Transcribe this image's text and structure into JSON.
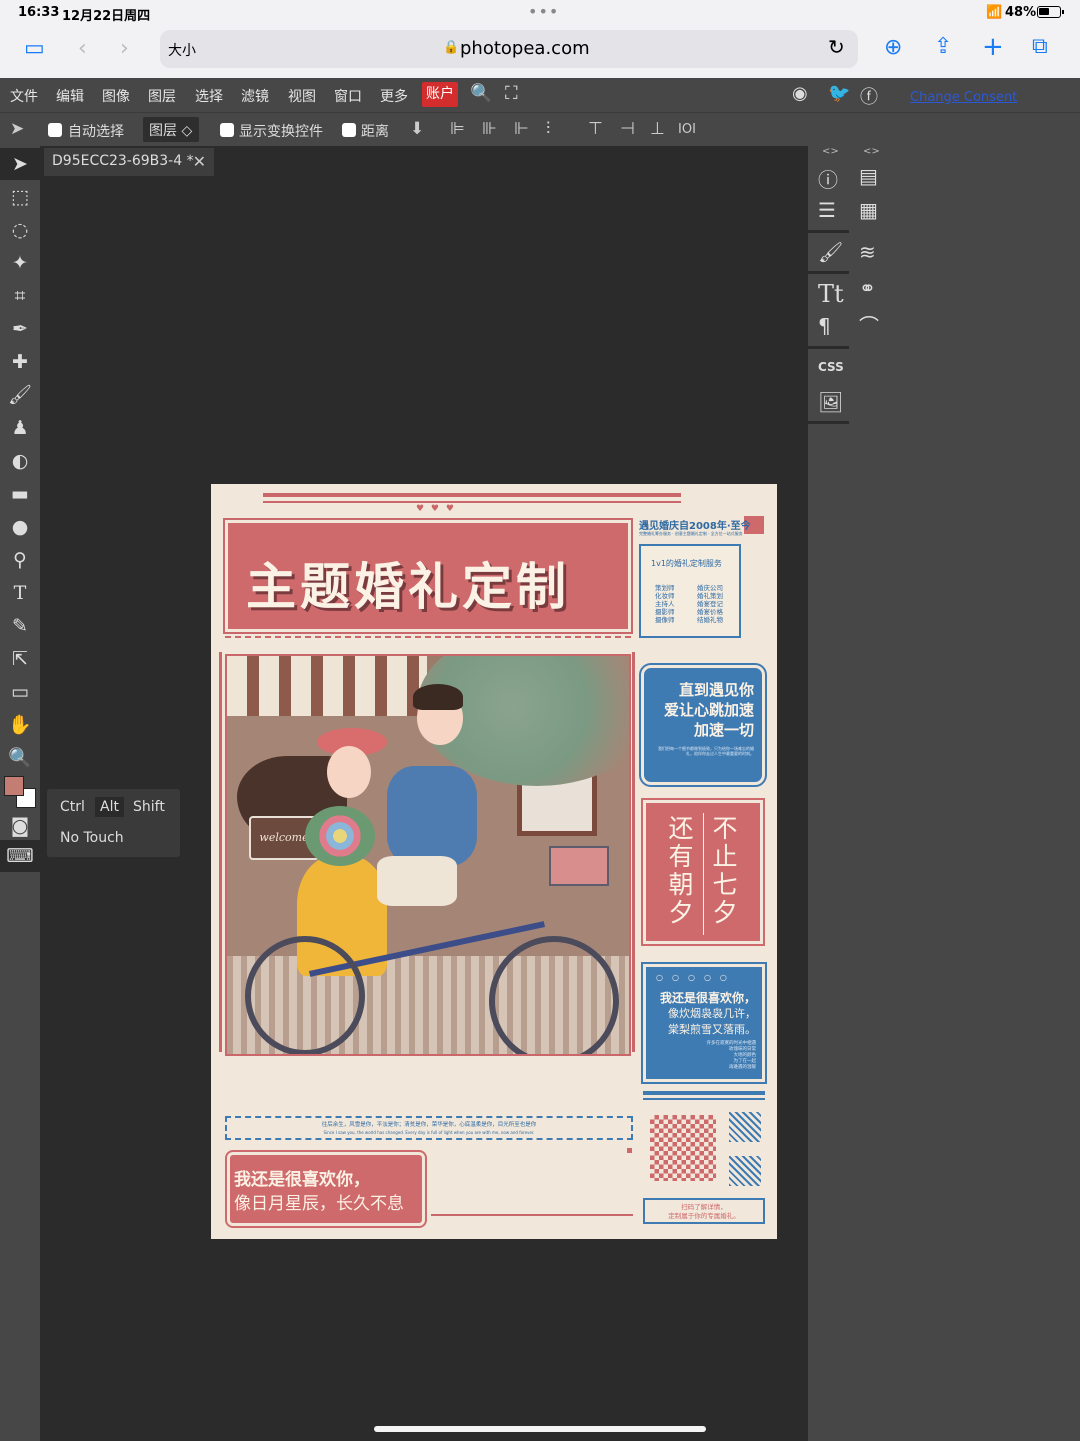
{
  "status": {
    "time": "16:33",
    "date": "12月22日周四",
    "battery": "48%"
  },
  "safari": {
    "text_size": "大小",
    "url": "photopea.com"
  },
  "menu": {
    "items": [
      "文件",
      "编辑",
      "图像",
      "图层",
      "选择",
      "滤镜",
      "视图",
      "窗口",
      "更多"
    ],
    "account": "账户",
    "consent": "Change Consent"
  },
  "options": {
    "auto_select": "自动选择",
    "layer_select": "图层 ◇",
    "show_transform": "显示变换控件",
    "distance": "距离"
  },
  "document": {
    "tab_title": "D95ECC23-69B3-4 *"
  },
  "keypop": {
    "ctrl": "Ctrl",
    "alt": "Alt",
    "shift": "Shift",
    "no_touch": "No Touch"
  },
  "colors": {
    "foreground": "#c47d73",
    "background": "#ffffff",
    "accent_red": "#d32d2d"
  },
  "poster": {
    "title": "主题婚礼定制",
    "hearts": "♥ ♥ ♥",
    "info_head": "遇见婚庆自2008年·至今",
    "info_sub": "完整婚礼筹办服务 · 创意主题婚礼定制 · 全方位一站式服务",
    "info_box_title": "1v1的婚礼定制服务",
    "info_col1": "策划师\n化妆师\n主持人\n摄影师\n摄像师",
    "info_col2": "婚庆公司\n婚礼策划\n婚宴登记\n婚宴价格\n结婚礼物",
    "blue1_text": "直到遇见你\n爱让心跳加速\n加速一切",
    "blue1_small": "我们把每一个细节都做到极致，只为给你一场难忘的婚礼，陪伴你走过人生中最重要的时刻。",
    "red_col1": "还有朝夕",
    "red_col2": "不止七夕",
    "sign": "welcome",
    "blue2_title": "我还是很喜欢你，",
    "blue2_text": "像炊烟袅袅几许，\n棠梨煎雪又落雨。",
    "blue2_small": "许多在寂寞的时光中相遇\n玫瑰味的日常\n大地的颜色\n为了在一起\n再难遇的温暖",
    "dash_text": "往后余生，风雪是你，平淡是你；清贫是你，荣华是你，心底温柔是你，目光所至也是你",
    "dash_text2": "Since I saw you, the world has changed. Every day is full of light when you are with me, now and forever.",
    "scan_text": "扫码了解详情，\n定制属于你的专属婚礼。",
    "bottom_line1": "我还是很喜欢你，",
    "bottom_line2": "像日月星辰，长久不息"
  }
}
